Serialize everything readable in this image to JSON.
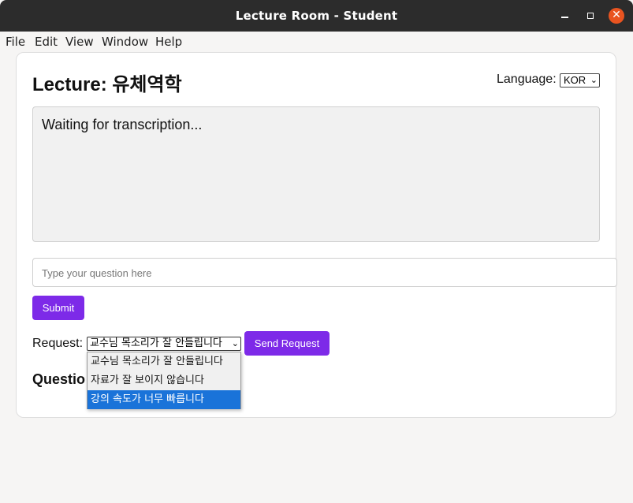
{
  "window": {
    "title": "Lecture Room - Student",
    "close_glyph": "✕"
  },
  "menubar": {
    "items": [
      "File",
      "Edit",
      "View",
      "Window",
      "Help"
    ]
  },
  "lecture": {
    "title": "Lecture: 유체역학"
  },
  "language": {
    "label": "Language:",
    "selected": "KOR",
    "chevron": "⌄"
  },
  "transcript": {
    "text": "Waiting for transcription..."
  },
  "question": {
    "placeholder": "Type your question here",
    "value": ""
  },
  "buttons": {
    "submit": "Submit",
    "send_request": "Send Request"
  },
  "request": {
    "label": "Request:",
    "selected": "교수님 목소리가 잘 안들립니다",
    "chevron": "⌄",
    "options": [
      "교수님 목소리가 잘 안들립니다",
      "자료가 잘 보이지 않습니다",
      "강의 속도가 너무 빠릅니다"
    ],
    "highlighted_index": 2
  },
  "questions_heading": "Questio",
  "colors": {
    "accent": "#7d2ae8",
    "highlight": "#1a73d9",
    "titlebar": "#2c2c2c",
    "close": "#e95420"
  }
}
